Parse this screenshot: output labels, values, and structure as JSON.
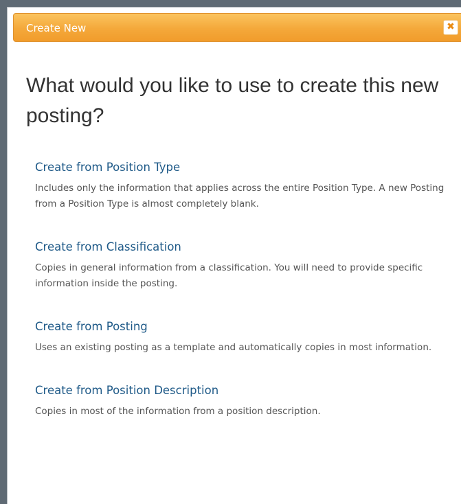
{
  "dialog": {
    "title": "Create New",
    "close_symbol": "✖",
    "heading": "What would you like to use to create this new posting?"
  },
  "options": [
    {
      "label": "Create from Position Type",
      "description": "Includes only the information that applies across the entire Position Type. A new Posting from a Position Type is almost completely blank."
    },
    {
      "label": "Create from Classification",
      "description": "Copies in general information from a classification. You will need to provide specific information inside the posting."
    },
    {
      "label": "Create from Posting",
      "description": "Uses an existing posting as a template and automatically copies in most information."
    },
    {
      "label": "Create from Position Description",
      "description": "Copies in most of the information from a position description."
    }
  ],
  "colors": {
    "titlebar": "#f4a83a",
    "link": "#1f5a88",
    "close_icon": "#e98a12"
  },
  "icons": {
    "close": "close-icon"
  }
}
